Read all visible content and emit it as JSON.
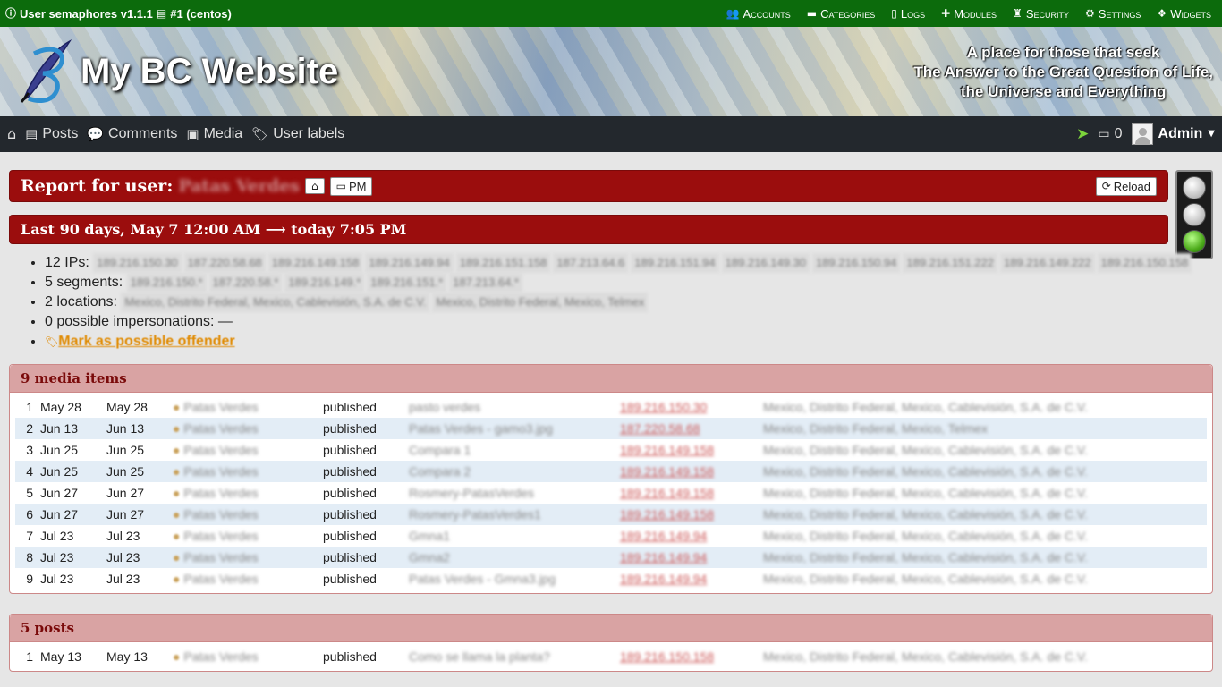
{
  "adminbar": {
    "title": "User semaphores v1.1.1",
    "instance": "#1 (centos)",
    "menu": [
      "Accounts",
      "Categories",
      "Logs",
      "Modules",
      "Security",
      "Settings",
      "Widgets"
    ]
  },
  "header": {
    "site_title": "My BC Website",
    "tagline": [
      "A place for those that seek",
      "The Answer to the Great Question of Life,",
      "the Universe and Everything"
    ]
  },
  "nav": {
    "items": [
      "Posts",
      "Comments",
      "Media",
      "User labels"
    ],
    "messages_count": "0",
    "user": "Admin"
  },
  "report": {
    "title": "Report for user:",
    "username": "Patas Verdes",
    "pm_label": "PM",
    "reload_label": "Reload",
    "range": "Last 90 days, May 7 12:00 AM ⟶ today 7:05 PM"
  },
  "summary": {
    "ips_label": "12 IPs:",
    "ips": [
      "189.216.150.30",
      "187.220.58.68",
      "189.216.149.158",
      "189.216.149.94",
      "189.216.151.158",
      "187.213.64.6",
      "189.216.151.94",
      "189.216.149.30",
      "189.216.150.94",
      "189.216.151.222",
      "189.216.149.222",
      "189.216.150.158"
    ],
    "segments_label": "5 segments:",
    "segments": [
      "189.216.150.*",
      "187.220.58.*",
      "189.216.149.*",
      "189.216.151.*",
      "187.213.64.*"
    ],
    "locations_label": "2 locations:",
    "locations": [
      "Mexico, Distrito Federal, Mexico, Cablevisión, S.A. de C.V.",
      "Mexico, Distrito Federal, Mexico, Telmex"
    ],
    "impersonations": "0 possible impersonations: —",
    "offender_link": "Mark as possible offender"
  },
  "media": {
    "title": "9 media items",
    "rows": [
      {
        "n": "1",
        "d1": "May 28",
        "d2": "May 28",
        "user": "Patas Verdes",
        "status": "published",
        "name": "pasto verdes",
        "ip": "189.216.150.30",
        "loc": "Mexico, Distrito Federal, Mexico, Cablevisión, S.A. de C.V."
      },
      {
        "n": "2",
        "d1": "Jun 13",
        "d2": "Jun 13",
        "user": "Patas Verdes",
        "status": "published",
        "name": "Patas Verdes - gamo3.jpg",
        "ip": "187.220.58.68",
        "loc": "Mexico, Distrito Federal, Mexico, Telmex"
      },
      {
        "n": "3",
        "d1": "Jun 25",
        "d2": "Jun 25",
        "user": "Patas Verdes",
        "status": "published",
        "name": "Compara 1",
        "ip": "189.216.149.158",
        "loc": "Mexico, Distrito Federal, Mexico, Cablevisión, S.A. de C.V."
      },
      {
        "n": "4",
        "d1": "Jun 25",
        "d2": "Jun 25",
        "user": "Patas Verdes",
        "status": "published",
        "name": "Compara 2",
        "ip": "189.216.149.158",
        "loc": "Mexico, Distrito Federal, Mexico, Cablevisión, S.A. de C.V."
      },
      {
        "n": "5",
        "d1": "Jun 27",
        "d2": "Jun 27",
        "user": "Patas Verdes",
        "status": "published",
        "name": "Rosmery-PatasVerdes",
        "ip": "189.216.149.158",
        "loc": "Mexico, Distrito Federal, Mexico, Cablevisión, S.A. de C.V."
      },
      {
        "n": "6",
        "d1": "Jun 27",
        "d2": "Jun 27",
        "user": "Patas Verdes",
        "status": "published",
        "name": "Rosmery-PatasVerdes1",
        "ip": "189.216.149.158",
        "loc": "Mexico, Distrito Federal, Mexico, Cablevisión, S.A. de C.V."
      },
      {
        "n": "7",
        "d1": "Jul 23",
        "d2": "Jul 23",
        "user": "Patas Verdes",
        "status": "published",
        "name": "Gmna1",
        "ip": "189.216.149.94",
        "loc": "Mexico, Distrito Federal, Mexico, Cablevisión, S.A. de C.V."
      },
      {
        "n": "8",
        "d1": "Jul 23",
        "d2": "Jul 23",
        "user": "Patas Verdes",
        "status": "published",
        "name": "Gmna2",
        "ip": "189.216.149.94",
        "loc": "Mexico, Distrito Federal, Mexico, Cablevisión, S.A. de C.V."
      },
      {
        "n": "9",
        "d1": "Jul 23",
        "d2": "Jul 23",
        "user": "Patas Verdes",
        "status": "published",
        "name": "Patas Verdes - Gmna3.jpg",
        "ip": "189.216.149.94",
        "loc": "Mexico, Distrito Federal, Mexico, Cablevisión, S.A. de C.V."
      }
    ]
  },
  "posts": {
    "title": "5 posts",
    "rows": [
      {
        "n": "1",
        "d1": "May 13",
        "d2": "May 13",
        "user": "Patas Verdes",
        "status": "published",
        "name": "Como se llama la planta?",
        "ip": "189.216.150.158",
        "loc": "Mexico, Distrito Federal, Mexico, Cablevisión, S.A. de C.V."
      }
    ]
  }
}
